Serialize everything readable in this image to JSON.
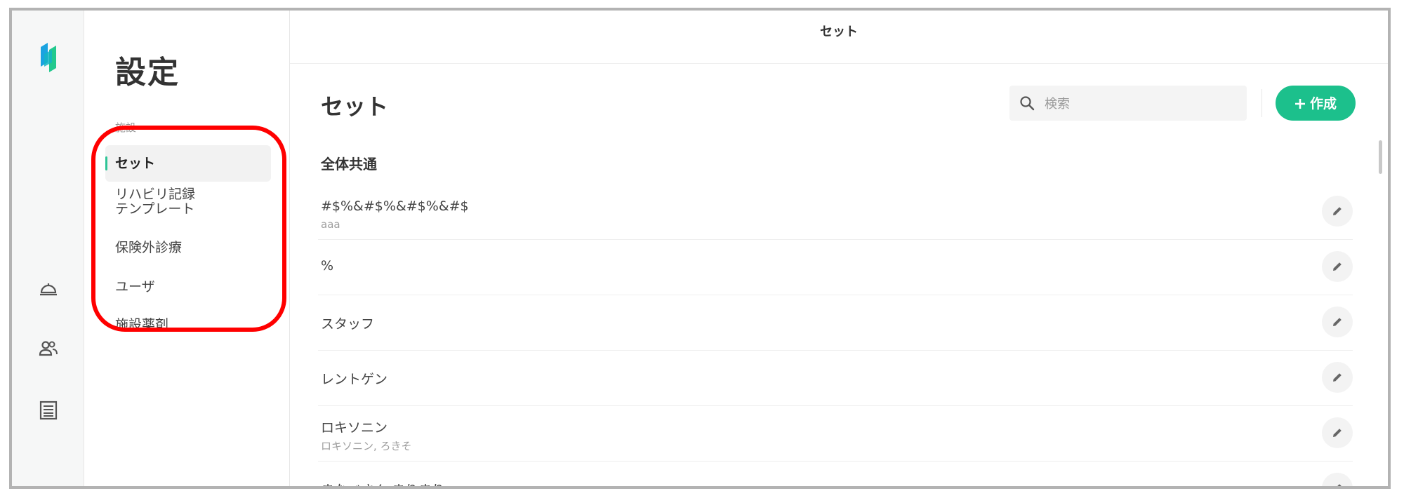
{
  "brand": {
    "accent": "#1cc08c",
    "highlight": "#ff0000"
  },
  "rail": {
    "icons": [
      "app-logo-icon",
      "reception-bell-icon",
      "users-icon",
      "list-icon"
    ]
  },
  "sidebar": {
    "title": "設定",
    "section": "施設",
    "items": [
      {
        "label": "セット",
        "active": true
      },
      {
        "label_line1": "リハビリ記録",
        "label_line2": "テンプレート"
      },
      {
        "label": "保険外診療"
      },
      {
        "label": "ユーザ"
      },
      {
        "label": "施設薬剤"
      }
    ]
  },
  "header": {
    "title": "セット"
  },
  "main": {
    "title": "セット",
    "search": {
      "placeholder": "検索",
      "value": ""
    },
    "create_label": "作成",
    "section": "全体共通",
    "rows": [
      {
        "title": "#$%&#$%&#$%&#$",
        "subtitle": "aaa"
      },
      {
        "title": "%",
        "subtitle": ""
      },
      {
        "title": "スタッフ",
        "subtitle": ""
      },
      {
        "title": "レントゲン",
        "subtitle": ""
      },
      {
        "title": "ロキソニン",
        "subtitle": "ロキソニン, ろきそ"
      },
      {
        "title": "まなべさん まりまり",
        "subtitle": ""
      }
    ]
  }
}
